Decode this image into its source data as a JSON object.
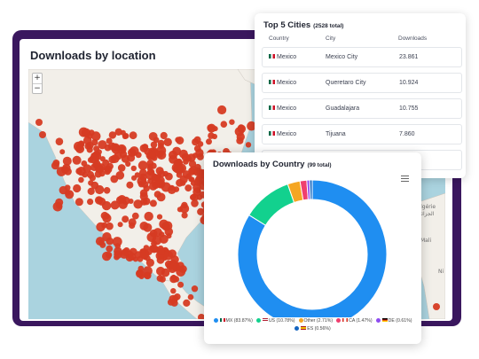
{
  "map": {
    "title": "Downloads by location",
    "zoom_in": "+",
    "zoom_out": "−",
    "labels": [
      "Algérie",
      "الجزائر",
      "Mali",
      "Ni"
    ]
  },
  "cities": {
    "title": "Top 5 Cities",
    "total": "(2528 total)",
    "headers": {
      "country": "Country",
      "city": "City",
      "downloads": "Downloads"
    },
    "rows": [
      {
        "country": "Mexico",
        "city": "Mexico City",
        "downloads": "23.861"
      },
      {
        "country": "Mexico",
        "city": "Queretaro City",
        "downloads": "10.924"
      },
      {
        "country": "Mexico",
        "city": "Guadalajara",
        "downloads": "10.755"
      },
      {
        "country": "Mexico",
        "city": "Tijuana",
        "downloads": "7.860"
      }
    ]
  },
  "country_chart": {
    "title": "Downloads by Country",
    "total": "(99 total)",
    "menu_icon": "hamburger-menu-icon"
  },
  "chart_data": {
    "type": "pie",
    "categories": [
      "MX",
      "US",
      "Other",
      "CA",
      "DE",
      "ES"
    ],
    "values": [
      83.87,
      10.78,
      2.71,
      1.47,
      0.61,
      0.56
    ],
    "legend_labels": [
      "MX (83.87%)",
      "US (10.78%)",
      "Other (2.71%)",
      "CA (1.47%)",
      "DE (0.61%)",
      "ES (0.56%)"
    ],
    "colors": [
      "#1f8ef1",
      "#12d18e",
      "#f5a623",
      "#f03e6e",
      "#8e4cf0",
      "#1565c0"
    ],
    "legend_placement": "bottom"
  }
}
